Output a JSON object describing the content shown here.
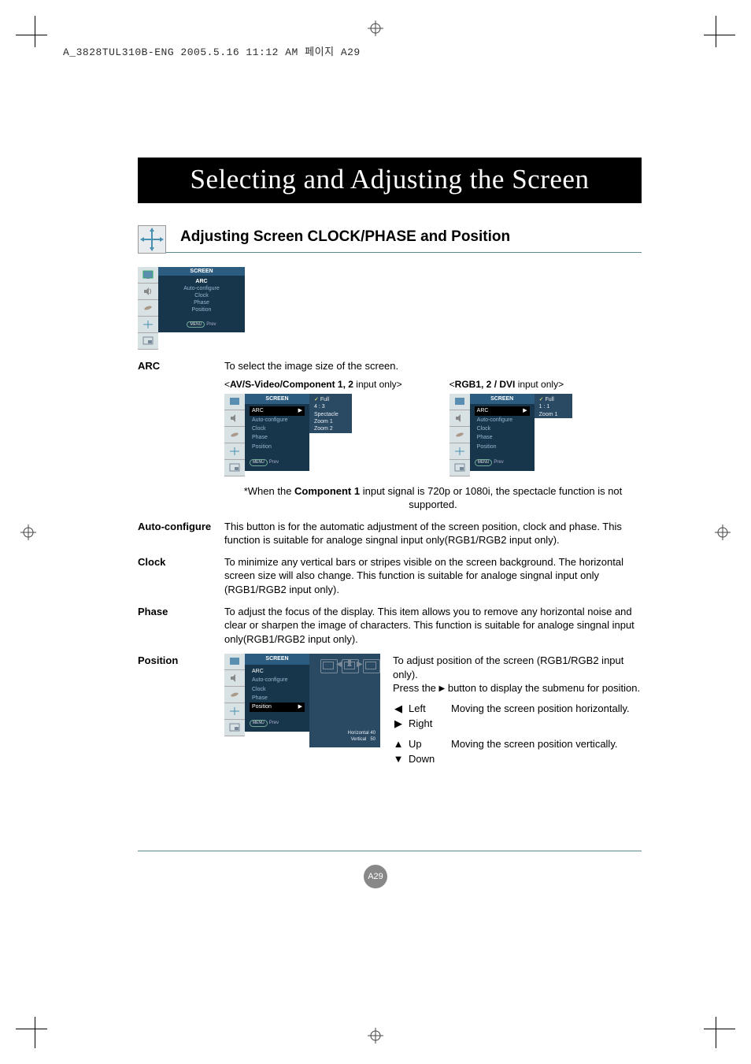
{
  "header_line": "A_3828TUL310B-ENG  2005.5.16  11:12 AM  페이지 A29",
  "banner": "Selecting and Adjusting the Screen",
  "subtitle": "Adjusting Screen CLOCK/PHASE and Position",
  "osd": {
    "title": "SCREEN",
    "items": [
      "ARC",
      "Auto-configure",
      "Clock",
      "Phase",
      "Position"
    ],
    "prev": "Prev",
    "menu": "MENU"
  },
  "arc": {
    "label": "ARC",
    "desc": "To select the image size of the screen.",
    "cap_left_pre": "<",
    "cap_left_bold": "AV/S-Video/Component 1, 2",
    "cap_left_post": " input only>",
    "cap_right_pre": "<",
    "cap_right_bold": "RGB1, 2 / DVI",
    "cap_right_post": " input only>",
    "left_opts": [
      "Full",
      "4 : 3",
      "Spectacle",
      "Zoom 1",
      "Zoom 2"
    ],
    "right_opts": [
      "Full",
      "1 : 1",
      "Zoom 1"
    ],
    "note_pre": "*When the ",
    "note_bold": "Component 1",
    "note_post": " input signal is 720p or 1080i, the spectacle function is not supported."
  },
  "auto": {
    "label": "Auto-configure",
    "desc": "This button is for the automatic adjustment of the screen position, clock and phase. This function is suitable for analoge singnal input only(RGB1/RGB2 input only)."
  },
  "clock": {
    "label": "Clock",
    "desc": "To minimize any vertical bars or stripes visible on the screen background. The horizontal screen size will also change. This function is suitable for analoge singnal input only (RGB1/RGB2 input only)."
  },
  "phase": {
    "label": "Phase",
    "desc": "To adjust the focus of the display. This item allows you to remove any horizontal noise and clear or sharpen the image of characters. This function is suitable for analoge singnal input only(RGB1/RGB2 input only)."
  },
  "position": {
    "label": "Position",
    "diagram": {
      "h_label": "Horizontal",
      "h_val": "40",
      "v_label": "Vertical",
      "v_val": "50"
    },
    "desc1": "To adjust position of the screen (RGB1/RGB2 input only).",
    "desc2_pre": "Press the ",
    "desc2_post": " button to display the submenu for position.",
    "dirs": {
      "left": "Left",
      "right": "Right",
      "up": "Up",
      "down": "Down",
      "h": "Moving the screen position horizontally.",
      "v": "Moving the screen position vertically."
    }
  },
  "page": "A29"
}
